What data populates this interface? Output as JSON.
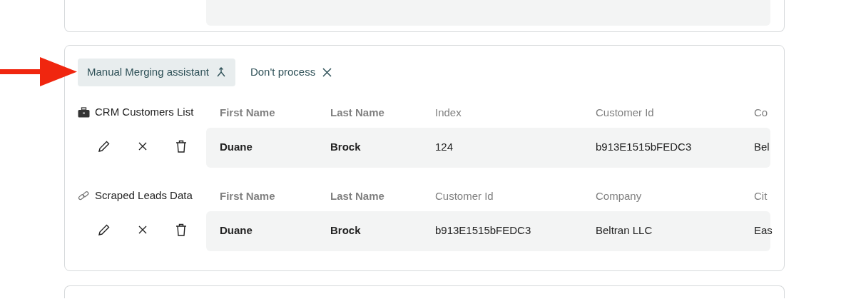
{
  "options": [
    {
      "label": "Manual Merging assistant",
      "kind": "merge",
      "selected": true
    },
    {
      "label": "Don't process",
      "kind": "close",
      "selected": false
    }
  ],
  "sources": [
    {
      "kind": "briefcase",
      "name": "CRM Customers List",
      "columns": [
        "First Name",
        "Last Name",
        "Index",
        "Customer Id",
        "Co"
      ],
      "values": [
        "Duane",
        "Brock",
        "124",
        "b913E1515bFEDC3",
        "Bel"
      ]
    },
    {
      "kind": "link",
      "name": "Scraped Leads Data",
      "columns": [
        "First Name",
        "Last Name",
        "Customer Id",
        "Company",
        "Cit"
      ],
      "values": [
        "Duane",
        "Brock",
        "b913E1515bFEDC3",
        "Beltran LLC",
        "Eas"
      ]
    }
  ]
}
